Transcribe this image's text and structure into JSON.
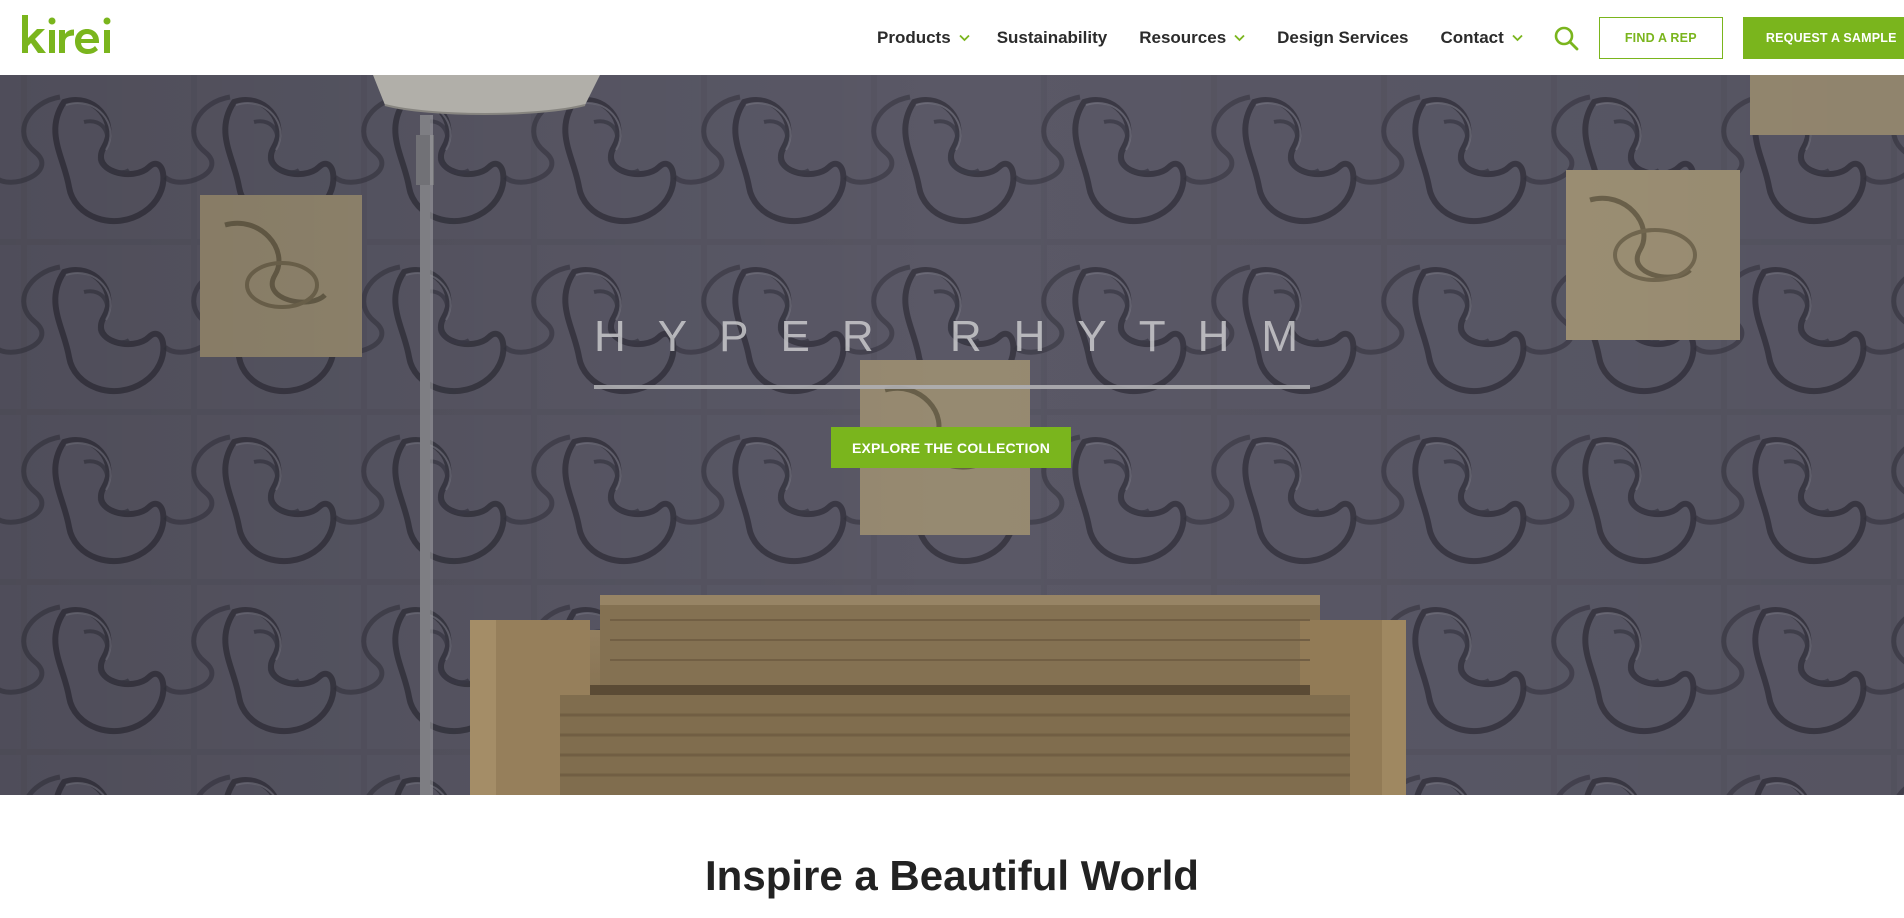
{
  "brand": {
    "logo_text": "kirei",
    "color": "#7ab51d"
  },
  "nav": {
    "items": [
      {
        "label": "Products",
        "dropdown": true
      },
      {
        "label": "Sustainability",
        "dropdown": false
      },
      {
        "label": "Resources",
        "dropdown": true
      },
      {
        "label": "Design Services",
        "dropdown": false
      },
      {
        "label": "Contact",
        "dropdown": true
      }
    ],
    "search_icon": "search-icon"
  },
  "actions": {
    "find_rep": "FIND A REP",
    "request_sample": "REQUEST A SAMPLE"
  },
  "hero": {
    "title": "HYPER RHYTHM",
    "cta": "EXPLORE THE COLLECTION"
  },
  "section": {
    "title": "Inspire a Beautiful World"
  },
  "colors": {
    "accent": "#7ab51d",
    "nav_text": "#2b2b2b",
    "felt": "#5f5d6d",
    "bench": "#a58a62"
  }
}
